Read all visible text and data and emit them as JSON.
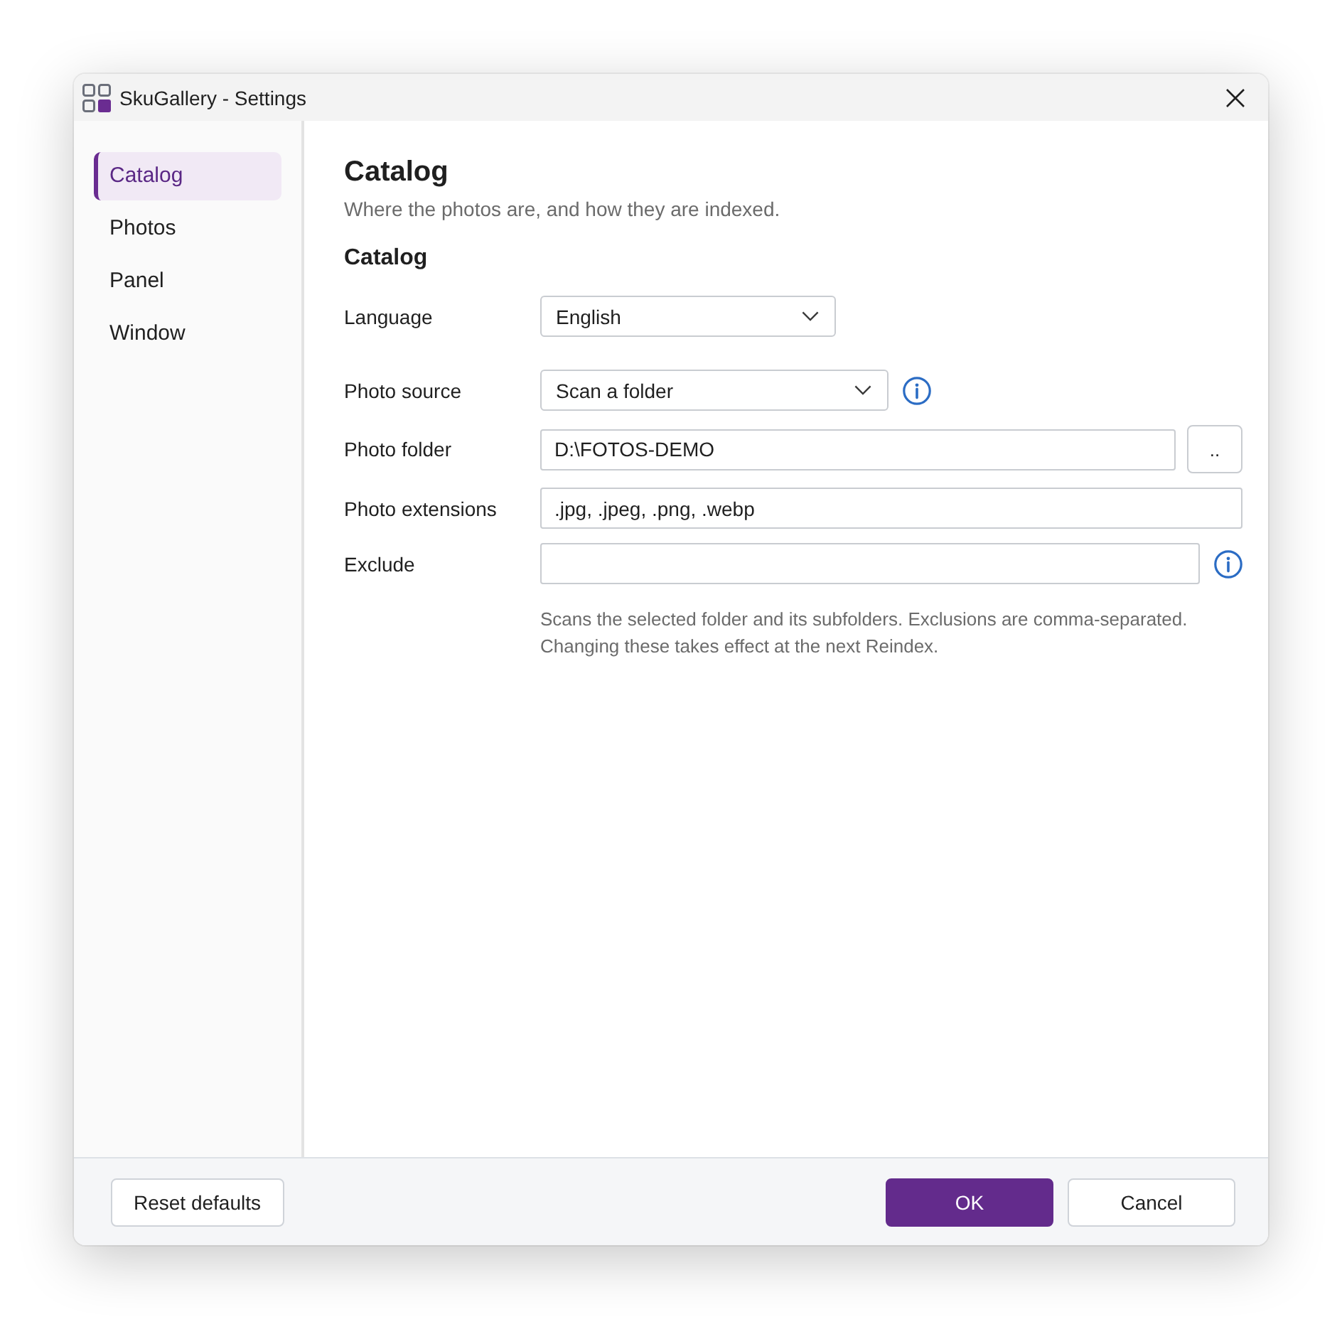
{
  "window": {
    "title": "SkuGallery - Settings"
  },
  "sidebar": {
    "items": [
      {
        "label": "Catalog",
        "selected": true
      },
      {
        "label": "Photos",
        "selected": false
      },
      {
        "label": "Panel",
        "selected": false
      },
      {
        "label": "Window",
        "selected": false
      }
    ]
  },
  "page": {
    "title": "Catalog",
    "subtitle": "Where the photos are, and how they are indexed."
  },
  "section": {
    "title": "Catalog",
    "fields": [
      {
        "kind": "dropdown",
        "label": "Language",
        "value": "English",
        "info": false
      },
      {
        "kind": "dropdown",
        "label": "Photo source",
        "value": "Scan a folder",
        "info": true
      },
      {
        "kind": "folder",
        "label": "Photo folder",
        "value": "D:\\FOTOS-DEMO",
        "button": "..",
        "info": false
      },
      {
        "kind": "text",
        "label": "Photo extensions",
        "value": ".jpg, .jpeg, .png, .webp",
        "info": false
      },
      {
        "kind": "text",
        "label": "Exclude",
        "info": true
      }
    ],
    "hint": "Scans the selected folder and its subfolders. Exclusions are comma-separated.\nChanging these takes effect at the next Reindex."
  },
  "footer": {
    "reset_button": "Reset defaults",
    "buttons": [
      {
        "label": "OK",
        "kind": "primary"
      },
      {
        "label": "Cancel",
        "kind": "secondary"
      }
    ]
  }
}
